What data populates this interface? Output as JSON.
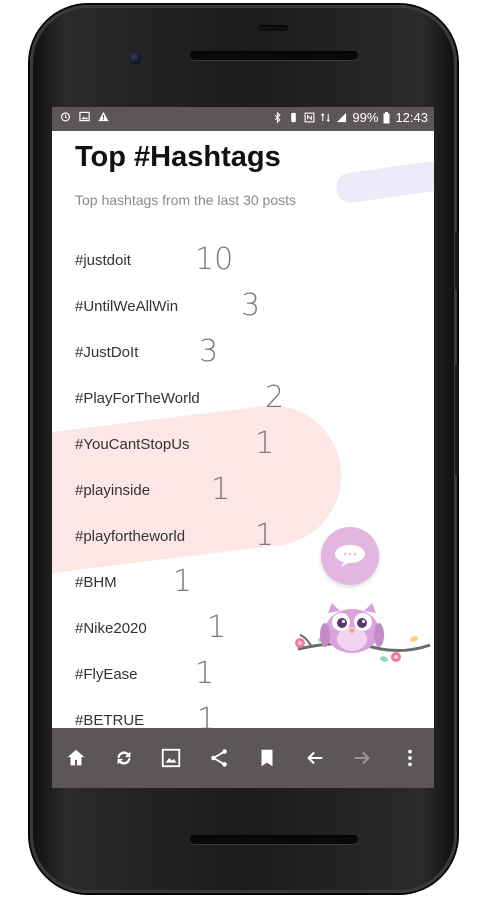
{
  "status_bar": {
    "left_icons": [
      "alarm-icon",
      "image-notification-icon",
      "warning-icon"
    ],
    "right_icons": [
      "bluetooth-icon",
      "vibrate-icon",
      "nfc-icon",
      "network-icon",
      "signal-icon"
    ],
    "battery": "99%",
    "time": "12:43"
  },
  "header": {
    "title": "Top #Hashtags",
    "subtitle": "Top hashtags from the last 30 posts"
  },
  "hashtags": [
    {
      "tag": "#justdoit",
      "count": "10"
    },
    {
      "tag": "#UntilWeAllWin",
      "count": "3"
    },
    {
      "tag": "#JustDoIt",
      "count": "3"
    },
    {
      "tag": "#PlayForTheWorld",
      "count": "2"
    },
    {
      "tag": "#YouCantStopUs",
      "count": "1"
    },
    {
      "tag": "#playinside",
      "count": "1"
    },
    {
      "tag": "#playfortheworld",
      "count": "1"
    },
    {
      "tag": "#BHM",
      "count": "1"
    },
    {
      "tag": "#Nike2020",
      "count": "1"
    },
    {
      "tag": "#FlyEase",
      "count": "1"
    },
    {
      "tag": "#BETRUE",
      "count": "1"
    }
  ],
  "nav_bar": {
    "buttons": [
      "home-icon",
      "refresh-icon",
      "image-icon",
      "share-icon",
      "bookmark-icon",
      "back-arrow-icon",
      "forward-arrow-icon",
      "more-vert-icon"
    ]
  },
  "colors": {
    "bar": "#5c5656",
    "pink_blob": "#fde7e6",
    "bubble": "#e3b6e1"
  }
}
